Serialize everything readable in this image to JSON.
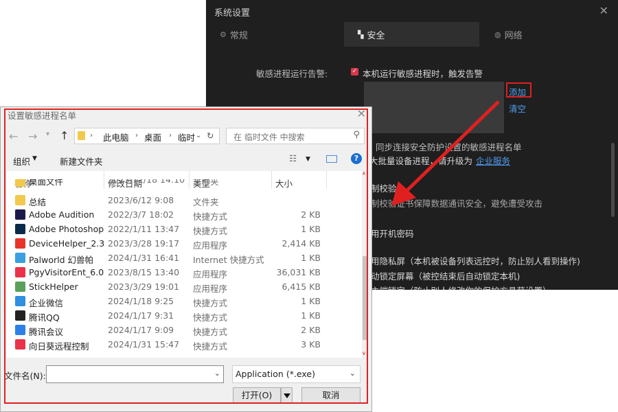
{
  "settings": {
    "title": "系统设置",
    "close_glyph": "✕",
    "tabs": [
      {
        "label": "常规",
        "icon": "gear-icon"
      },
      {
        "label": "安全",
        "icon": "lock-icon"
      },
      {
        "label": "网络",
        "icon": "globe-icon"
      }
    ],
    "alert_label": "敏感进程运行告警:",
    "alert_checkbox_label": "本机运行敏感进程时，触发告警",
    "add_link": "添加",
    "clear_link": "清空",
    "sync_text": "同步连接安全防护设置的敏感进程名单",
    "batch_prefix": "大批量设备进程，请升级为",
    "enterprise_link": "企业服务",
    "verify_title": "制校验",
    "verify_desc": "制校验证书保障数据通讯安全，避免遭受攻击",
    "boot_password": "用开机密码",
    "privacy_screen": "用隐私屏（本机被设备列表远控时，防止别人看到操作)",
    "auto_lock": "动锁定屏幕（被控结束后自动锁定本机)",
    "cut_off": "主端锁定（防止别人修改你的保护方具苷设置）"
  },
  "dialog": {
    "title": "设置敏感进程名单",
    "close_glyph": "✕",
    "path": [
      "此电脑",
      "桌面",
      "临时"
    ],
    "search_placeholder": "在 临时文件 中搜索",
    "organize": "组织",
    "new_folder": "新建文件夹",
    "columns": [
      "名称",
      "修改日期",
      "类型",
      "大小"
    ],
    "rows": [
      {
        "name": "桌面文件",
        "date": "2023/12/18 14:10",
        "type": "文件夹",
        "size": "",
        "icon": "folder-icon",
        "color": "#f2c94c"
      },
      {
        "name": "总结",
        "date": "2023/6/12 9:08",
        "type": "文件夹",
        "size": "",
        "icon": "folder-icon",
        "color": "#f2c94c"
      },
      {
        "name": "Adobe Audition",
        "date": "2022/3/7 18:02",
        "type": "快捷方式",
        "size": "2 KB",
        "icon": "adobe-audition-icon",
        "color": "#1a1a4a"
      },
      {
        "name": "Adobe Photoshop",
        "date": "2022/1/11 13:47",
        "type": "快捷方式",
        "size": "1 KB",
        "icon": "adobe-photoshop-icon",
        "color": "#0b2a4a"
      },
      {
        "name": "DeviceHelper_2.3",
        "date": "2023/3/28 19:17",
        "type": "应用程序",
        "size": "2,414 KB",
        "icon": "devicehelper-icon",
        "color": "#e8332a"
      },
      {
        "name": "Palworld  幻兽帕",
        "date": "2024/1/31 16:41",
        "type": "Internet 快捷方式",
        "size": "1 KB",
        "icon": "palworld-icon",
        "color": "#3aa0e0"
      },
      {
        "name": "PgyVisitorEnt_6.0",
        "date": "2023/8/15 13:40",
        "type": "应用程序",
        "size": "36,031 KB",
        "icon": "pgyvisitor-icon",
        "color": "#e8334a"
      },
      {
        "name": "StickHelper",
        "date": "2023/3/29 19:01",
        "type": "应用程序",
        "size": "6,415 KB",
        "icon": "stickhelper-icon",
        "color": "#5aa05a"
      },
      {
        "name": "企业微信",
        "date": "2024/1/18 9:25",
        "type": "快捷方式",
        "size": "1 KB",
        "icon": "wecom-icon",
        "color": "#2f8fe0"
      },
      {
        "name": "腾讯QQ",
        "date": "2024/1/17 9:31",
        "type": "快捷方式",
        "size": "1 KB",
        "icon": "qq-icon",
        "color": "#222222"
      },
      {
        "name": "腾讯会议",
        "date": "2024/1/17 9:09",
        "type": "快捷方式",
        "size": "2 KB",
        "icon": "tencent-meeting-icon",
        "color": "#2f7fe8"
      },
      {
        "name": "向日葵远程控制",
        "date": "2024/1/31 15:47",
        "type": "快捷方式",
        "size": "3 KB",
        "icon": "sunlogin-icon",
        "color": "#e8334a"
      }
    ],
    "filename_label": "文件名(N):",
    "filename_value": "",
    "filetype_value": "Application (*.exe)",
    "open_button": "打开(O)",
    "cancel_button": "取消"
  },
  "colors": {
    "accent_red": "#e02020",
    "link_blue": "#4f9cf0",
    "dark_bg": "#1f1f1f"
  }
}
